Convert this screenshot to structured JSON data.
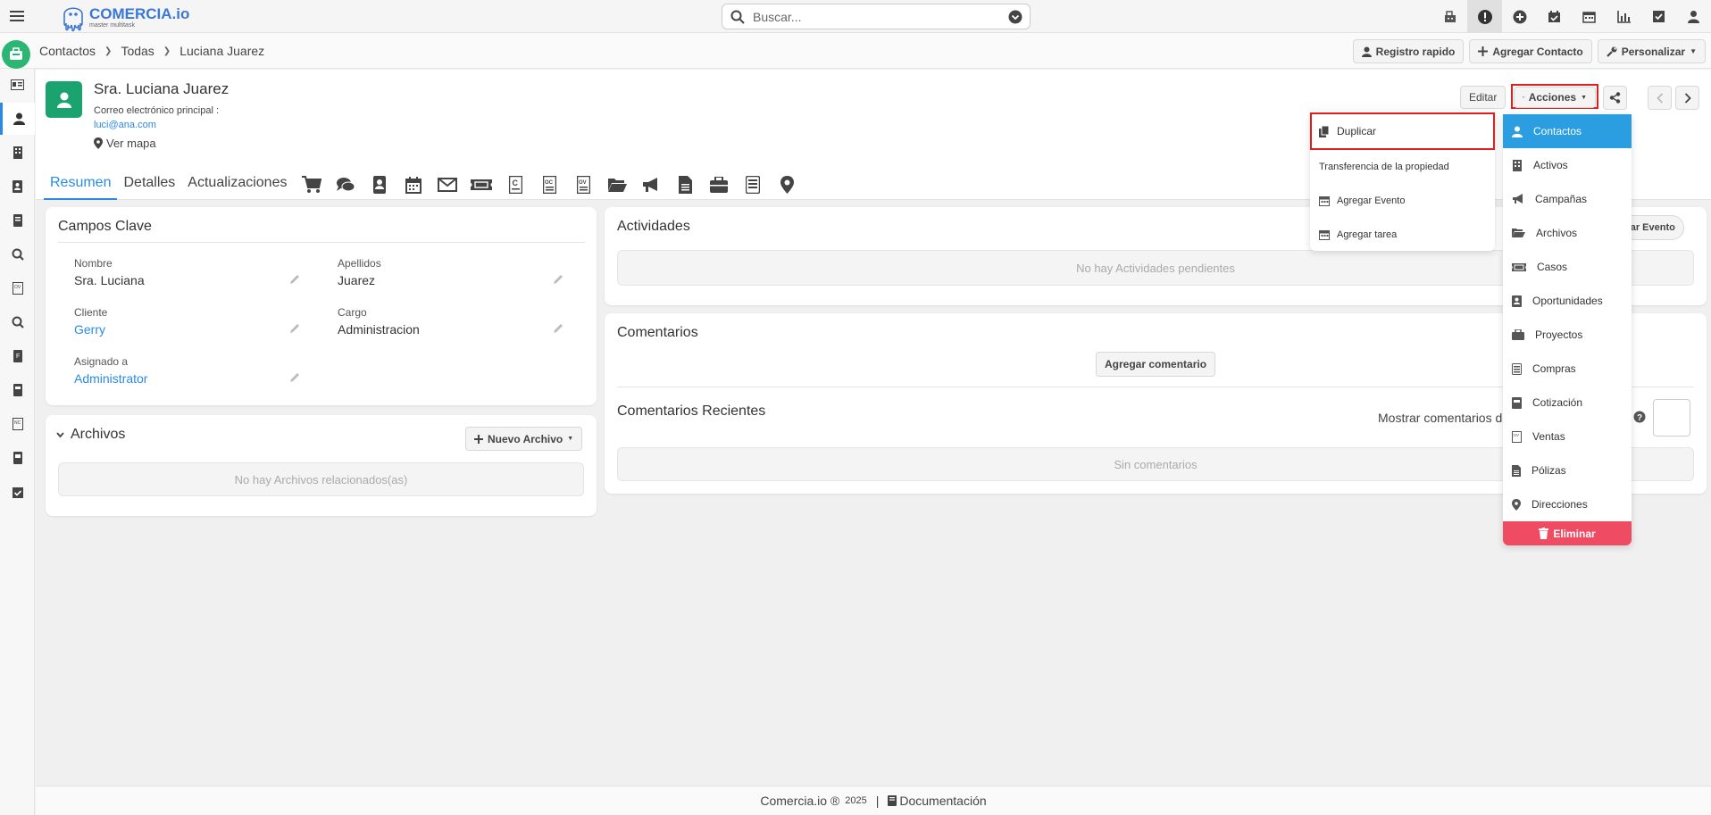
{
  "topbar": {
    "logo_title": "COMERCIA.io",
    "logo_sub": "master multitask",
    "search_placeholder": "Buscar...",
    "icons": [
      "fax-icon",
      "alert-icon",
      "plus-circle-icon",
      "calendar-check-icon",
      "calendar-icon",
      "bar-chart-icon",
      "checkbox-icon",
      "user-icon"
    ]
  },
  "breadcrumb": [
    "Contactos",
    "Todas",
    "Luciana Juarez"
  ],
  "subbar_actions": {
    "quick_register": "Registro rapido",
    "add_contact": "Agregar Contacto",
    "customize": "Personalizar"
  },
  "record": {
    "name": "Sra. Luciana Juarez",
    "email_label": "Correo electrónico principal :",
    "email": "luci@ana.com",
    "map_label": "Ver mapa",
    "edit_label": "Editar",
    "actions_label": "Acciones"
  },
  "tabs": [
    "Resumen",
    "Detalles",
    "Actualizaciones"
  ],
  "key_fields": {
    "title": "Campos Clave",
    "fields": [
      {
        "label": "Nombre",
        "value": "Sra. Luciana"
      },
      {
        "label": "Apellidos",
        "value": "Juarez"
      },
      {
        "label": "Cliente",
        "value": "Gerry"
      },
      {
        "label": "Cargo",
        "value": "Administracion"
      },
      {
        "label": "Asignado a",
        "value": "Administrator"
      }
    ]
  },
  "files": {
    "title": "Archivos",
    "new_file": "Nuevo Archivo",
    "empty": "No hay Archivos relacionados(as)"
  },
  "activities": {
    "title": "Actividades",
    "add_event_partial": "gar Evento",
    "empty": "No hay Actividades pendientes"
  },
  "comments": {
    "title": "Comentarios",
    "add_comment": "Agregar comentario",
    "recent_title": "Comentarios Recientes",
    "show_label": "Mostrar comentarios de",
    "empty": "Sin comentarios"
  },
  "actions_menu": {
    "items": [
      "Duplicar",
      "Transferencia de la propiedad",
      "Agregar Evento",
      "Agregar tarea"
    ]
  },
  "related_menu": {
    "items": [
      "Contactos",
      "Activos",
      "Campañas",
      "Archivos",
      "Casos",
      "Oportunidades",
      "Proyectos",
      "Compras",
      "Cotización",
      "Ventas",
      "Pólizas",
      "Direcciones"
    ],
    "delete": "Eliminar"
  },
  "footer": {
    "brand": "Comercia.io ®",
    "year": "2025",
    "docs": "Documentación"
  },
  "colors": {
    "accent": "#2a8ae8",
    "green": "#1aa36f",
    "highlight": "#e01e1e",
    "danger": "#ef4b63"
  }
}
